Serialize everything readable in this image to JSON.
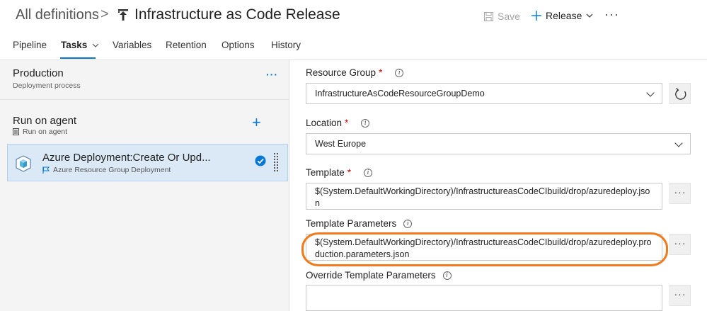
{
  "header": {
    "breadcrumb_root": "All definitions",
    "separator": ">",
    "title": "Infrastructure as Code Release",
    "save_label": "Save",
    "release_label": "Release",
    "more": "···"
  },
  "tabs": [
    {
      "label": "Pipeline"
    },
    {
      "label": "Tasks"
    },
    {
      "label": "Variables"
    },
    {
      "label": "Retention"
    },
    {
      "label": "Options"
    },
    {
      "label": "History"
    }
  ],
  "left_panel": {
    "stage": {
      "name": "Production",
      "subtitle": "Deployment process",
      "more": "···"
    },
    "job": {
      "name": "Run on agent",
      "subtitle": "Run on agent",
      "add": "+"
    },
    "task": {
      "name": "Azure Deployment:Create Or Upd...",
      "subtitle": "Azure Resource Group Deployment"
    }
  },
  "form": {
    "resource_group": {
      "label": "Resource Group",
      "required": "*",
      "value": "InfrastructureAsCodeResourceGroupDemo"
    },
    "location": {
      "label": "Location",
      "required": "*",
      "value": "West Europe"
    },
    "template": {
      "label": "Template",
      "required": "*",
      "value": "$(System.DefaultWorkingDirectory)/InfrastructureasCodeCIbuild/drop/azuredeploy.json"
    },
    "template_parameters": {
      "label": "Template Parameters",
      "value": "$(System.DefaultWorkingDirectory)/InfrastructureasCodeCIbuild/drop/azuredeploy.production.parameters.json"
    },
    "override_parameters": {
      "label": "Override Template Parameters",
      "value": ""
    },
    "more_button": "···",
    "info_glyph": "i"
  },
  "colors": {
    "accent": "#0078d4",
    "highlight": "#f07b1d",
    "selected_task_bg": "#dbe9f7"
  }
}
